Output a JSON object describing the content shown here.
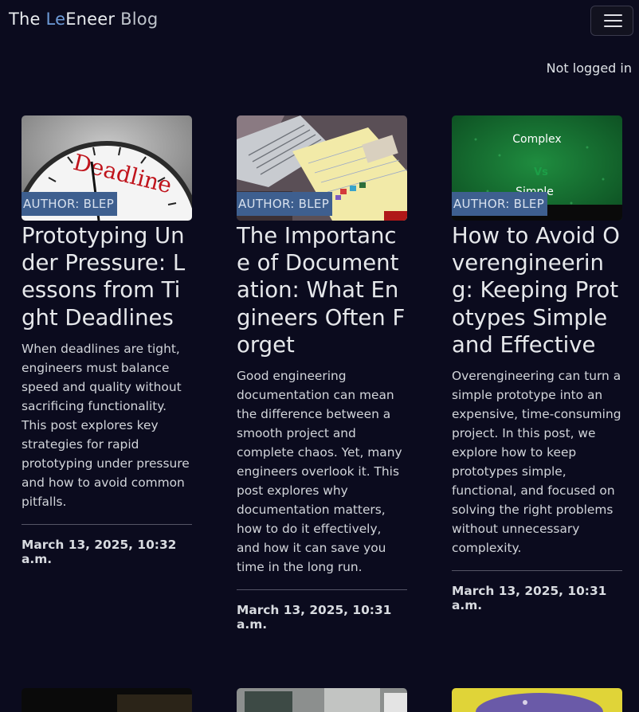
{
  "navbar": {
    "brand_prefix": "The ",
    "brand_le": "Le",
    "brand_eneer": "Eneer",
    "brand_suffix": " Blog",
    "toggler_icon": "hamburger-icon"
  },
  "status": {
    "login_text": "Not logged in"
  },
  "posts": [
    {
      "author": "AUTHOR: BLEP",
      "title": "Prototyping Under Pressure: Lessons from Tight Deadlines",
      "excerpt": "When deadlines are tight, engineers must balance speed and quality without sacrificing functionality. This post explores key strategies for rapid prototyping under pressure and how to avoid common pitfalls.",
      "date": "March 13, 2025, 10:32 a.m.",
      "image_text": "Deadline"
    },
    {
      "author": "AUTHOR: BLEP",
      "title": "The Importance of Documentation: What Engineers Often Forget",
      "excerpt": "Good engineering documentation can mean the difference between a smooth project and complete chaos. Yet, many engineers overlook it. This post explores why documentation matters, how to do it effectively, and how it can save you time in the long run.",
      "date": "March 13, 2025, 10:31 a.m."
    },
    {
      "author": "AUTHOR: BLEP",
      "title": "How to Avoid Overengineering: Keeping Prototypes Simple and Effective",
      "excerpt": "Overengineering can turn a simple prototype into an expensive, time-consuming project. In this post, we explore how to keep prototypes simple, functional, and focused on solving the right problems without unnecessary complexity.",
      "date": "March 13, 2025, 10:31 a.m.",
      "image_text_top": "Complex",
      "image_text_mid": "Vs",
      "image_text_bottom": "Simple"
    }
  ],
  "colors": {
    "background": "#0b0b1e",
    "accent": "#6e9bd8",
    "author_badge": "#3e5f8f"
  }
}
